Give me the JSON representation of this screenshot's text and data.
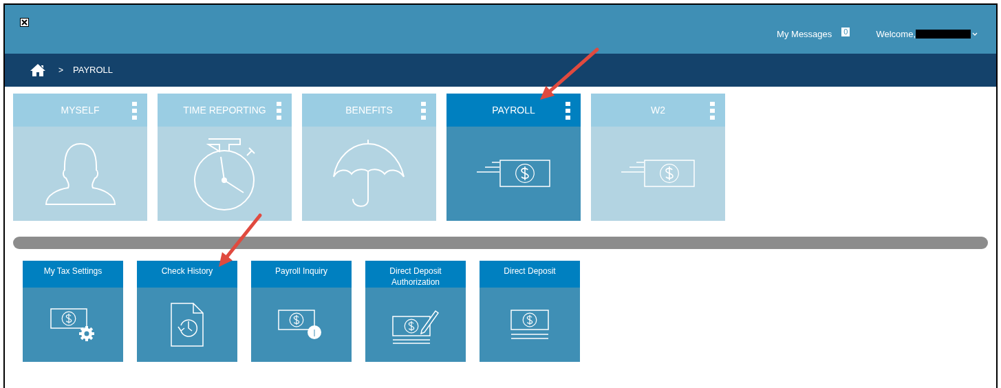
{
  "header": {
    "messages_label": "My Messages",
    "messages_count": "0",
    "welcome": "Welcome,"
  },
  "breadcrumb": {
    "separator": ">",
    "current": "PAYROLL"
  },
  "tiles": [
    {
      "label": "MYSELF",
      "selected": false,
      "kind": "person"
    },
    {
      "label": "TIME REPORTING",
      "selected": false,
      "kind": "stopwatch"
    },
    {
      "label": "BENEFITS",
      "selected": false,
      "kind": "umbrella"
    },
    {
      "label": "PAYROLL",
      "selected": true,
      "kind": "money"
    },
    {
      "label": "W2",
      "selected": false,
      "kind": "money"
    }
  ],
  "sub_tiles": [
    {
      "label": "My Tax Settings",
      "kind": "money-gear"
    },
    {
      "label": "Check History",
      "kind": "document-history"
    },
    {
      "label": "Payroll Inquiry",
      "kind": "money-info"
    },
    {
      "label": "Direct Deposit Authorization",
      "kind": "money-pencil"
    },
    {
      "label": "Direct Deposit",
      "kind": "money-lines"
    }
  ]
}
